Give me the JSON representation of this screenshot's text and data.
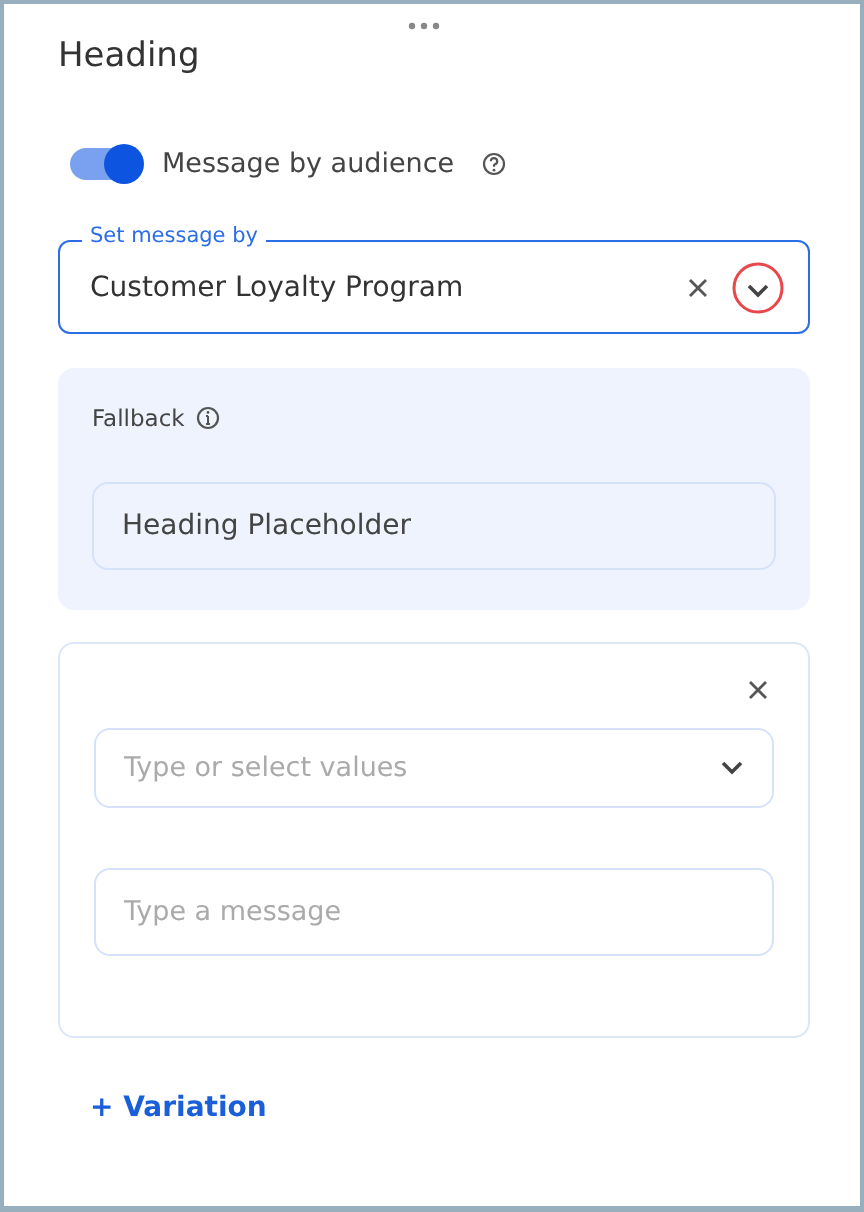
{
  "panel": {
    "title": "Heading"
  },
  "audience_toggle": {
    "label": "Message by audience",
    "on": true
  },
  "set_message_by": {
    "label": "Set message by",
    "value": "Customer Loyalty Program",
    "highlighted": true
  },
  "fallback": {
    "label": "Fallback",
    "value": "Heading Placeholder"
  },
  "variations": [
    {
      "values_placeholder": "Type or select values",
      "message_placeholder": "Type a message"
    }
  ],
  "add_variation": "+ Variation"
}
